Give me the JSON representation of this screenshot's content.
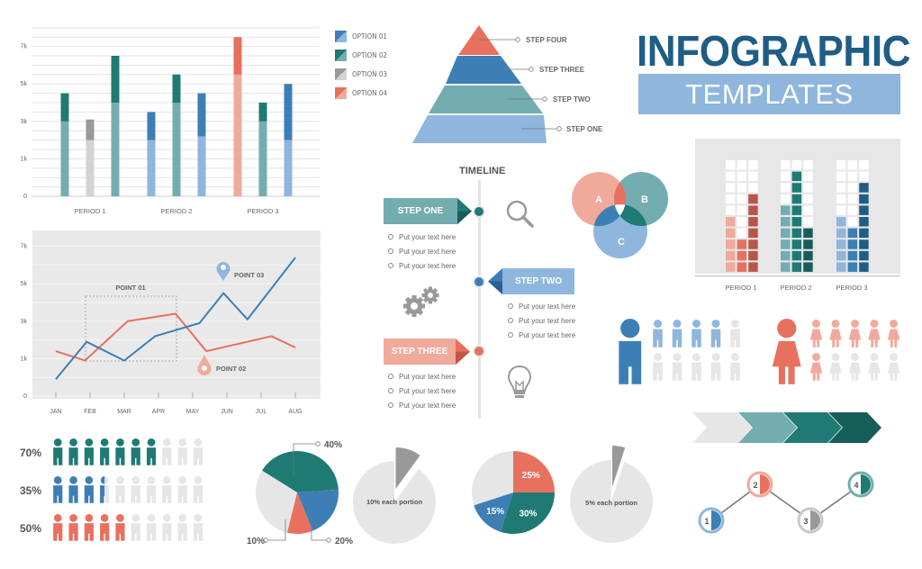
{
  "title": {
    "main": "INFOGRAPHIC",
    "sub": "TEMPLATES"
  },
  "colors": {
    "blue_dark": "#3d7fb5",
    "blue_light": "#8fb6dd",
    "teal_dark": "#1f7a74",
    "teal_light": "#74adb0",
    "gray_dark": "#999999",
    "gray_light": "#d3d3d3",
    "red_dark": "#e8705f",
    "red_light": "#f0aa9c",
    "navy": "#1f5d86"
  },
  "chart_data": [
    {
      "id": "stacked-bars",
      "type": "bar",
      "title": "",
      "xlabel": "",
      "ylabel": "",
      "ytick_labels": [
        "0",
        "1k",
        "3k",
        "5k",
        "7k"
      ],
      "ylim_grid_units": [
        0,
        18
      ],
      "grid": true,
      "legend_position": "right",
      "legend": [
        "OPTION 01",
        "OPTION 02",
        "OPTION 03",
        "OPTION 04"
      ],
      "categories": [
        "PERIOD 1",
        "PERIOD 2",
        "PERIOD 3"
      ],
      "note": "values in gridline units (each labeled tick = 4 gridline units: 0→0, 1k→4, 3k→8, 5k→12, 7k→16)",
      "bars": [
        {
          "period": "PERIOD 1",
          "option": "OPTION 02",
          "base": 8,
          "top": 11
        },
        {
          "period": "PERIOD 1",
          "option": "OPTION 03",
          "base": 6,
          "top": 8.2
        },
        {
          "period": "PERIOD 1",
          "option": "OPTION 02",
          "base": 10,
          "top": 15
        },
        {
          "period": "PERIOD 2",
          "option": "OPTION 01",
          "base": 6,
          "top": 9
        },
        {
          "period": "PERIOD 2",
          "option": "OPTION 02",
          "base": 10,
          "top": 13
        },
        {
          "period": "PERIOD 2",
          "option": "OPTION 01",
          "base": 6.4,
          "top": 11
        },
        {
          "period": "PERIOD 3",
          "option": "OPTION 04",
          "base": 13,
          "top": 17
        },
        {
          "period": "PERIOD 3",
          "option": "OPTION 02",
          "base": 8,
          "top": 10
        },
        {
          "period": "PERIOD 3",
          "option": "OPTION 01",
          "base": 6,
          "top": 12
        }
      ]
    },
    {
      "id": "line-chart",
      "type": "line",
      "title": "",
      "xlabel": "",
      "ylabel": "",
      "x": [
        "JAN",
        "FEB",
        "MAR",
        "APR",
        "MAY",
        "JUN",
        "JUL",
        "AUG"
      ],
      "ytick_labels": [
        "0",
        "1k",
        "3k",
        "5k",
        "7k"
      ],
      "grid": true,
      "note": "values in gridline units (each labeled tick = 2 gridline units: 0→0, 1k→2, 3k→4, 5k→6, 7k→8); x in month-index units",
      "series": [
        {
          "name": "blue",
          "points": [
            [
              0,
              0.9
            ],
            [
              0.9,
              2.9
            ],
            [
              2,
              1.9
            ],
            [
              2.9,
              3.2
            ],
            [
              4.2,
              3.9
            ],
            [
              4.9,
              5.5
            ],
            [
              5.6,
              4.1
            ],
            [
              7,
              7.4
            ]
          ]
        },
        {
          "name": "red",
          "points": [
            [
              0,
              2.4
            ],
            [
              0.85,
              1.9
            ],
            [
              2.1,
              4.0
            ],
            [
              3.5,
              4.4
            ],
            [
              4.4,
              2.4
            ],
            [
              6.3,
              3.2
            ],
            [
              7,
              2.6
            ]
          ]
        }
      ],
      "annotations": [
        "POINT 01",
        "POINT 02",
        "POINT 03"
      ]
    },
    {
      "id": "pie-1",
      "type": "pie",
      "slices": [
        {
          "label": "40%",
          "value": 40,
          "color": "teal"
        },
        {
          "label": "20%",
          "value": 20,
          "color": "blue"
        },
        {
          "label": "10%",
          "value": 10,
          "color": "red"
        },
        {
          "label": "",
          "value": 30,
          "color": "gray"
        }
      ]
    },
    {
      "id": "pie-2",
      "type": "pie",
      "caption": "10% each portion",
      "slices": [
        {
          "label": "",
          "value": 10,
          "color": "gray-dark"
        },
        {
          "label": "",
          "value": 90,
          "color": "gray-light"
        }
      ]
    },
    {
      "id": "pie-3",
      "type": "pie",
      "slices": [
        {
          "label": "25%",
          "value": 25,
          "color": "red"
        },
        {
          "label": "30%",
          "value": 30,
          "color": "teal"
        },
        {
          "label": "15%",
          "value": 15,
          "color": "blue"
        },
        {
          "label": "",
          "value": 30,
          "color": "gray"
        }
      ]
    },
    {
      "id": "pie-4",
      "type": "pie",
      "caption": "5% each portion",
      "slices": [
        {
          "label": "",
          "value": 5,
          "color": "gray-dark"
        },
        {
          "label": "",
          "value": 95,
          "color": "gray-light"
        }
      ]
    },
    {
      "id": "waffle",
      "type": "bar",
      "categories": [
        "PERIOD 1",
        "PERIOD 2",
        "PERIOD 3"
      ],
      "cells_per_column": 10,
      "columns": [
        [
          5,
          3,
          7
        ],
        [
          6,
          9,
          4
        ],
        [
          5,
          4,
          8
        ]
      ]
    }
  ],
  "legend": [
    "OPTION 01",
    "OPTION 02",
    "OPTION 03",
    "OPTION 04"
  ],
  "pyramid": [
    "STEP FOUR",
    "STEP THREE",
    "STEP TWO",
    "STEP ONE"
  ],
  "timeline": {
    "title": "TIMELINE",
    "steps": [
      {
        "label": "STEP ONE",
        "items": [
          "Put your text here",
          "Put your text here",
          "Put your text here"
        ]
      },
      {
        "label": "STEP TWO",
        "items": [
          "Put your text here",
          "Put your text here",
          "Put your text here"
        ]
      },
      {
        "label": "STEP THREE",
        "items": [
          "Put your text here",
          "Put your text here",
          "Put your text here"
        ]
      }
    ]
  },
  "venn": [
    "A",
    "B",
    "C"
  ],
  "people_rows": [
    {
      "label": "70%",
      "filled": 7,
      "total": 10
    },
    {
      "label": "35%",
      "filled": 3.5,
      "total": 10
    },
    {
      "label": "50%",
      "filled": 5,
      "total": 10
    }
  ],
  "gender": {
    "male_filled": 4,
    "female_filled": 6,
    "total": 10
  },
  "process_nodes": [
    "1",
    "2",
    "3",
    "4"
  ],
  "chevrons": 4
}
